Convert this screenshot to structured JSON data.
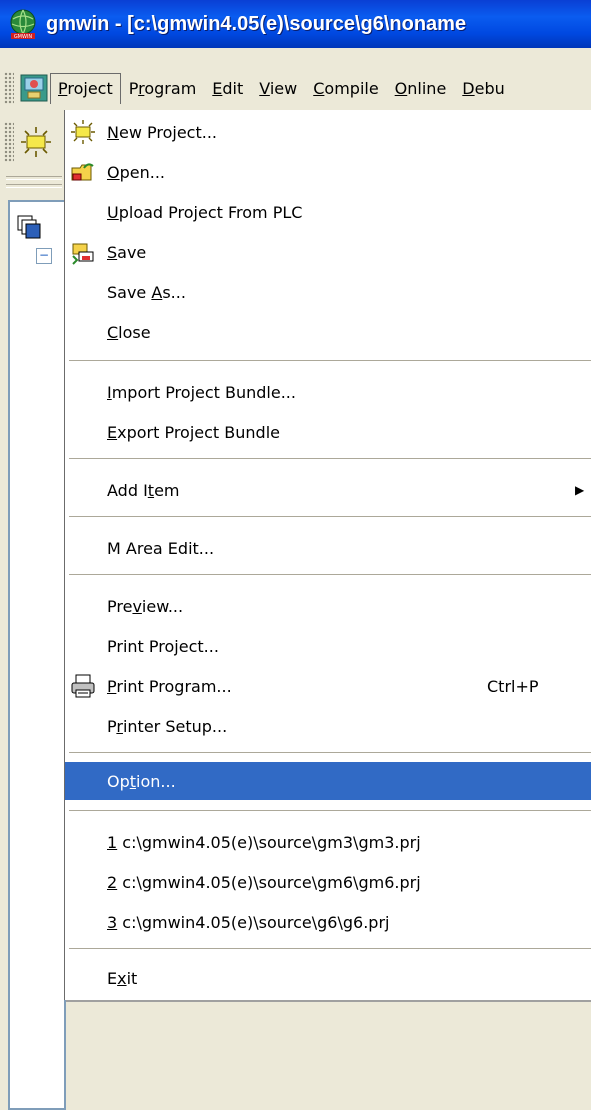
{
  "window": {
    "title": "gmwin - [c:\\gmwin4.05(e)\\source\\g6\\noname"
  },
  "menubar": {
    "items": [
      {
        "label": "Project",
        "mnemonic": "P",
        "active": true
      },
      {
        "label": "Program",
        "mnemonic": "r"
      },
      {
        "label": "Edit",
        "mnemonic": "E"
      },
      {
        "label": "View",
        "mnemonic": "V"
      },
      {
        "label": "Compile",
        "mnemonic": "C"
      },
      {
        "label": "Online",
        "mnemonic": "O"
      },
      {
        "label": "Debu",
        "mnemonic": "D"
      }
    ]
  },
  "project_menu": {
    "new_project": {
      "pre": "",
      "ul": "N",
      "post": "ew Project...",
      "icon": "new-project-icon"
    },
    "open": {
      "pre": "",
      "ul": "O",
      "post": "pen...",
      "icon": "open-folder-icon"
    },
    "upload": {
      "pre": "",
      "ul": "U",
      "post": "pload Project From PLC"
    },
    "save": {
      "pre": "",
      "ul": "S",
      "post": "ave",
      "icon": "save-icon"
    },
    "save_as": {
      "pre": "Save ",
      "ul": "A",
      "post": "s..."
    },
    "close": {
      "pre": "",
      "ul": "C",
      "post": "lose"
    },
    "import_bundle": {
      "pre": "",
      "ul": "I",
      "post": "mport Project Bundle..."
    },
    "export_bundle": {
      "pre": "",
      "ul": "E",
      "post": "xport Project Bundle"
    },
    "add_item": {
      "pre": "Add I",
      "ul": "t",
      "post": "em"
    },
    "m_area_edit": {
      "pre": "M Area Edit...",
      "ul": "",
      "post": ""
    },
    "preview": {
      "pre": "Pre",
      "ul": "v",
      "post": "iew..."
    },
    "print_project": {
      "pre": "Print Pro",
      "ul": "j",
      "post": "ect..."
    },
    "print_program": {
      "pre": "",
      "ul": "P",
      "post": "rint Program...",
      "shortcut": "Ctrl+P",
      "icon": "printer-icon"
    },
    "printer_setup": {
      "pre": "P",
      "ul": "r",
      "post": "inter Setup..."
    },
    "option": {
      "pre": "Op",
      "ul": "t",
      "post": "ion..."
    },
    "recent_1": {
      "pre": "",
      "ul": "1",
      "post": " c:\\gmwin4.05(e)\\source\\gm3\\gm3.prj"
    },
    "recent_2": {
      "pre": "",
      "ul": "2",
      "post": " c:\\gmwin4.05(e)\\source\\gm6\\gm6.prj"
    },
    "recent_3": {
      "pre": "",
      "ul": "3",
      "post": " c:\\gmwin4.05(e)\\source\\g6\\g6.prj"
    },
    "exit": {
      "pre": "E",
      "ul": "x",
      "post": "it"
    }
  },
  "colors": {
    "titlebar": "#0a5cf0",
    "highlight": "#316ac5",
    "menu_bg": "#ffffff",
    "chrome_bg": "#ece9d8"
  }
}
